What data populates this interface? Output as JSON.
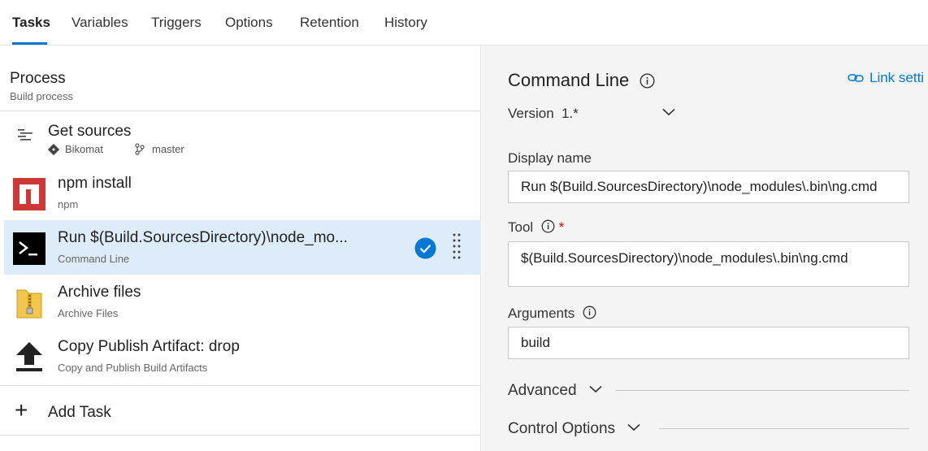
{
  "tabs": [
    "Tasks",
    "Variables",
    "Triggers",
    "Options",
    "Retention",
    "History"
  ],
  "process": {
    "title": "Process",
    "subtitle": "Build process"
  },
  "get_sources": {
    "title": "Get sources",
    "repo": "Bikomat",
    "branch": "master"
  },
  "tasks": [
    {
      "title": "npm install",
      "subtitle": "npm"
    },
    {
      "title": "Run $(Build.SourcesDirectory)\\node_mo...",
      "subtitle": "Command Line"
    },
    {
      "title": "Archive files",
      "subtitle": "Archive Files"
    },
    {
      "title": "Copy Publish Artifact: drop",
      "subtitle": "Copy and Publish Build Artifacts"
    }
  ],
  "add_task_label": "Add Task",
  "details": {
    "title": "Command Line",
    "link_settings": "Link setti",
    "version_label": "Version",
    "version_value": "1.*",
    "display_name_label": "Display name",
    "display_name_value": "Run $(Build.SourcesDirectory)\\node_modules\\.bin\\ng.cmd",
    "tool_label": "Tool",
    "tool_required": "*",
    "tool_value": "$(Build.SourcesDirectory)\\node_modules\\.bin\\ng.cmd",
    "arguments_label": "Arguments",
    "arguments_value": "build",
    "advanced_label": "Advanced",
    "control_options_label": "Control Options"
  },
  "colors": {
    "accent": "#0078d4",
    "selected_row": "#deecf9",
    "npm_red": "#cb3837"
  }
}
